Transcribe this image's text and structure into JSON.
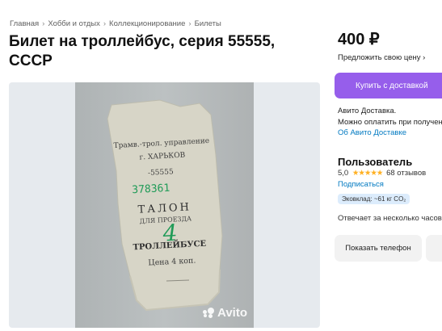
{
  "breadcrumb": {
    "items": [
      "Главная",
      "Хобби и отдых",
      "Коллекционирование",
      "Билеты"
    ],
    "separator": "›"
  },
  "listing": {
    "title": "Билет на троллейбус, серия 55555, СССР",
    "price": "400 ₽",
    "offer_price_link": "Предложить свою цену ›"
  },
  "photo": {
    "watermark": "Avito",
    "ticket": {
      "line1": "Трамв.-трол. управление",
      "line2": "г. ХАРЬКОВ",
      "series": "-55555",
      "number": "378361",
      "talon": "ТАЛОН",
      "for_travel": "ДЛЯ ПРОЕЗДА",
      "digit": "4",
      "vehicle": "ТРОЛЛЕЙБУСЕ",
      "price": "Цена 4 коп."
    }
  },
  "sidebar": {
    "buy_button": "Купить с доставкой",
    "delivery_line1": "Авито Доставка.",
    "delivery_line2": "Можно оплатить при получении",
    "delivery_link": "Об Авито Доставке",
    "seller_name": "Пользователь",
    "rating_value": "5,0",
    "stars": "★★★★★",
    "reviews": "68 отзывов",
    "subscribe": "Подписаться",
    "eco_badge": "Эковклад: ~61 кг CO₂",
    "reply_time": "Отвечает за несколько часов",
    "phone_button": "Показать телефон"
  },
  "colors": {
    "accent": "#965eeb",
    "link": "#0079c1",
    "star": "#ffb021",
    "ticket_green": "#1f9b57"
  },
  "icons": {
    "star": "star-icon",
    "chevron": "chevron-right-icon",
    "watermark": "avito-logo-icon"
  }
}
